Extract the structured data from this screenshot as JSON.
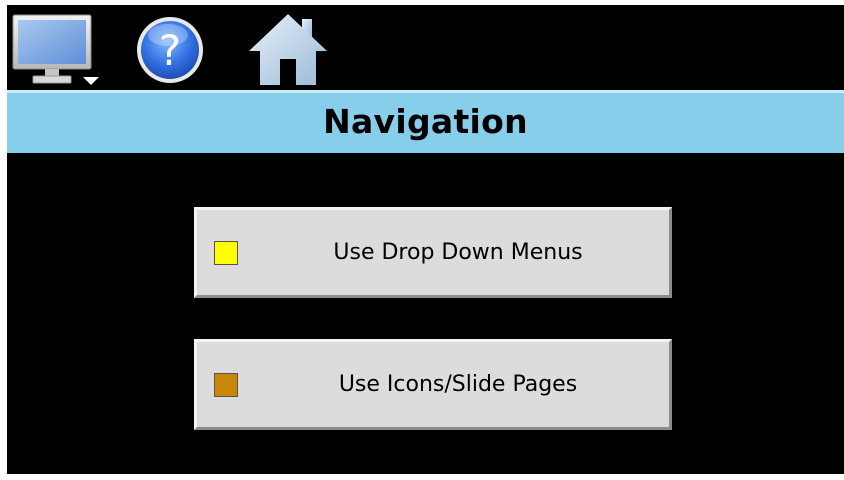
{
  "toolbar": {
    "icons": [
      {
        "name": "monitor-icon"
      },
      {
        "name": "help-icon",
        "glyph": "?"
      },
      {
        "name": "home-icon"
      }
    ]
  },
  "title": "Navigation",
  "options": [
    {
      "label": "Use Drop Down Menus",
      "indicator_color": "#ffff00",
      "selected": true
    },
    {
      "label": "Use Icons/Slide Pages",
      "indicator_color": "#c8860a",
      "selected": false
    }
  ],
  "colors": {
    "title_bar": "#87ceeb",
    "background": "#000000",
    "button_face": "#dcdcdc"
  }
}
